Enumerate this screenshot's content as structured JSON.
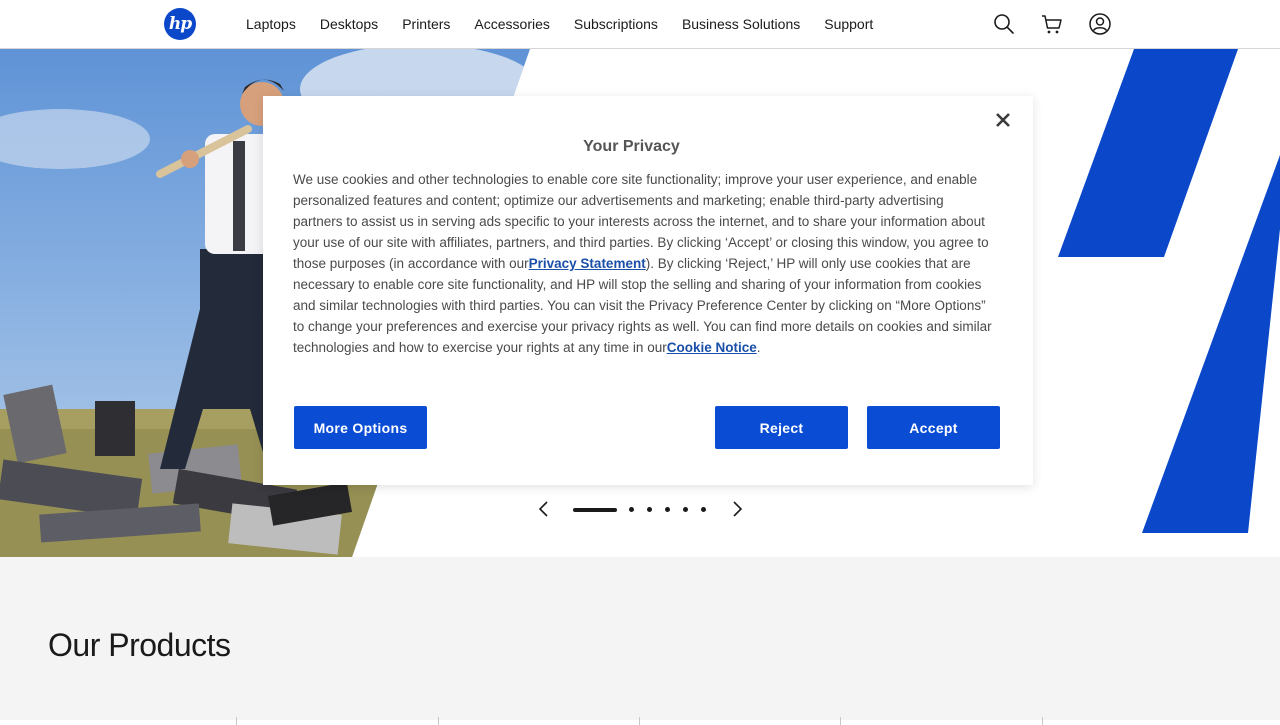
{
  "header": {
    "logo_text": "hp",
    "nav": [
      "Laptops",
      "Desktops",
      "Printers",
      "Accessories",
      "Subscriptions",
      "Business Solutions",
      "Support"
    ],
    "icons": [
      "search-icon",
      "cart-icon",
      "account-icon"
    ]
  },
  "hero": {
    "carousel": {
      "active_index": 0,
      "slide_count": 6
    }
  },
  "products": {
    "title": "Our Products"
  },
  "modal": {
    "title": "Your Privacy",
    "body_part1": "We use cookies and other technologies to enable core site functionality; improve your user experience, and enable personalized features and content; optimize our advertisements and marketing; enable third-party advertising partners to assist us in serving ads specific to your interests across the internet, and to share your information about your use of our site with affiliates, partners, and third parties. By clicking ‘Accept’ or closing this window, you agree to those purposes (in accordance with our",
    "privacy_link": "Privacy Statement",
    "body_part2": "). By clicking ‘Reject,’ HP will only use cookies that are necessary to enable core site functionality, and HP will stop the selling and sharing of your information from cookies and similar technologies with third parties. You can visit the Privacy Preference Center by clicking on “More Options” to change your preferences and exercise your privacy rights as well. You can find more details on cookies and similar technologies and how to exercise your rights at any time in our",
    "cookie_link": "Cookie Notice",
    "body_part3": ".",
    "more_options": "More Options",
    "reject": "Reject",
    "accept": "Accept"
  },
  "colors": {
    "brand_blue": "#0a47c9",
    "button_blue": "#0a4dd4",
    "link_blue": "#1a4fa8"
  }
}
